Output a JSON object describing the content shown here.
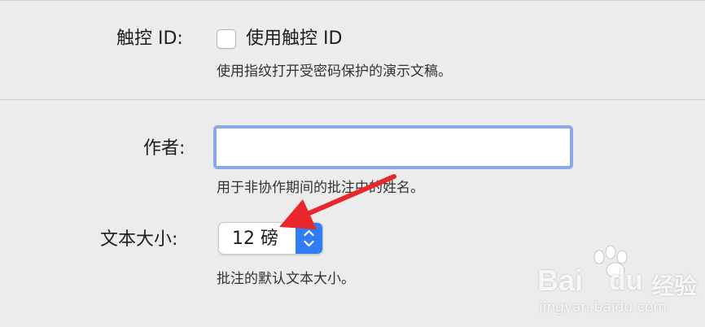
{
  "touch_id": {
    "label": "触控 ID:",
    "checkbox_label": "使用触控 ID",
    "checked": false,
    "help": "使用指纹打开受密码保护的演示文稿。"
  },
  "author": {
    "label": "作者:",
    "value": "",
    "help": "用于非协作期间的批注中的姓名。"
  },
  "text_size": {
    "label": "文本大小:",
    "value": "12 磅",
    "help": "批注的默认文本大小。"
  },
  "colors": {
    "accent": "#2f7cf6",
    "focus_ring": "#8aa8e6",
    "annotation_arrow": "#e8282c",
    "background": "#ececec"
  },
  "icons": {
    "checkbox": "checkbox-unchecked",
    "stepper": "up-down-chevron-icon",
    "annotation": "red-arrow-icon",
    "watermark_logo": "paw-logo"
  },
  "watermark": {
    "brand": "Bai",
    "brand_suffix": "du",
    "cn": "经验",
    "url": "jingyan.baidu.com"
  }
}
